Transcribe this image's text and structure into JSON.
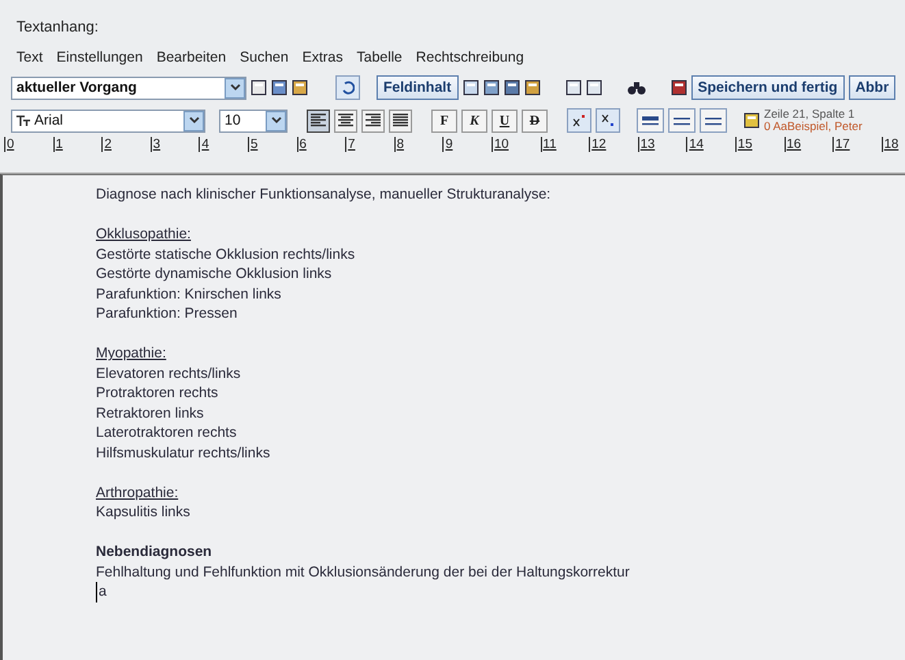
{
  "window": {
    "title": "Textanhang:"
  },
  "menu": [
    "Text",
    "Einstellungen",
    "Bearbeiten",
    "Suchen",
    "Extras",
    "Tabelle",
    "Rechtschreibung"
  ],
  "toolbar": {
    "record_select": {
      "value": "aktueller Vorgang"
    },
    "field_button": "Feldinhalt",
    "save_button": "Speichern und fertig",
    "cancel_button": "Abbr"
  },
  "format_bar": {
    "font_select": {
      "value": "Arial"
    },
    "size_select": {
      "value": "10"
    },
    "align_buttons": [
      {
        "selected": true
      },
      {
        "selected": false
      },
      {
        "selected": false
      },
      {
        "selected": false
      }
    ],
    "style_buttons": [
      "F",
      "K",
      "U",
      "D"
    ],
    "status": {
      "position": "Zeile 21, Spalte 1",
      "user": "0 AaBeispiel, Peter"
    }
  },
  "ruler": [
    "0",
    "1",
    "2",
    "3",
    "4",
    "5",
    "6",
    "7",
    "8",
    "9",
    "10",
    "11",
    "12",
    "13",
    "14",
    "15",
    "16",
    "17",
    "18"
  ],
  "document": {
    "blocks": [
      {
        "lines": [
          {
            "kind": "plain",
            "text": "Diagnose nach klinischer Funktionsanalyse, manueller Strukturanalyse:"
          }
        ]
      },
      {
        "lines": [
          {
            "kind": "heading",
            "text": "Okklusopathie:"
          },
          {
            "kind": "plain",
            "text": "Gestörte statische Okklusion rechts/links"
          },
          {
            "kind": "plain",
            "text": "Gestörte dynamische Okklusion links"
          },
          {
            "kind": "plain",
            "text": "Parafunktion: Knirschen links"
          },
          {
            "kind": "plain",
            "text": "Parafunktion: Pressen"
          }
        ]
      },
      {
        "lines": [
          {
            "kind": "heading",
            "text": "Myopathie:"
          },
          {
            "kind": "plain",
            "text": "Elevatoren rechts/links"
          },
          {
            "kind": "plain",
            "text": "Protraktoren rechts"
          },
          {
            "kind": "plain",
            "text": "Retraktoren links"
          },
          {
            "kind": "plain",
            "text": "Laterotraktoren rechts"
          },
          {
            "kind": "plain",
            "text": "Hilfsmuskulatur rechts/links"
          }
        ]
      },
      {
        "lines": [
          {
            "kind": "heading",
            "text": "Arthropathie:"
          },
          {
            "kind": "plain",
            "text": "Kapsulitis links"
          }
        ]
      },
      {
        "lines": [
          {
            "kind": "bold",
            "text": "Nebendiagnosen"
          },
          {
            "kind": "plain",
            "text": "Fehlhaltung und Fehlfunktion mit Okklusionsänderung der bei der Haltungskorrektur"
          },
          {
            "kind": "cursor",
            "text": "a"
          }
        ]
      }
    ]
  }
}
